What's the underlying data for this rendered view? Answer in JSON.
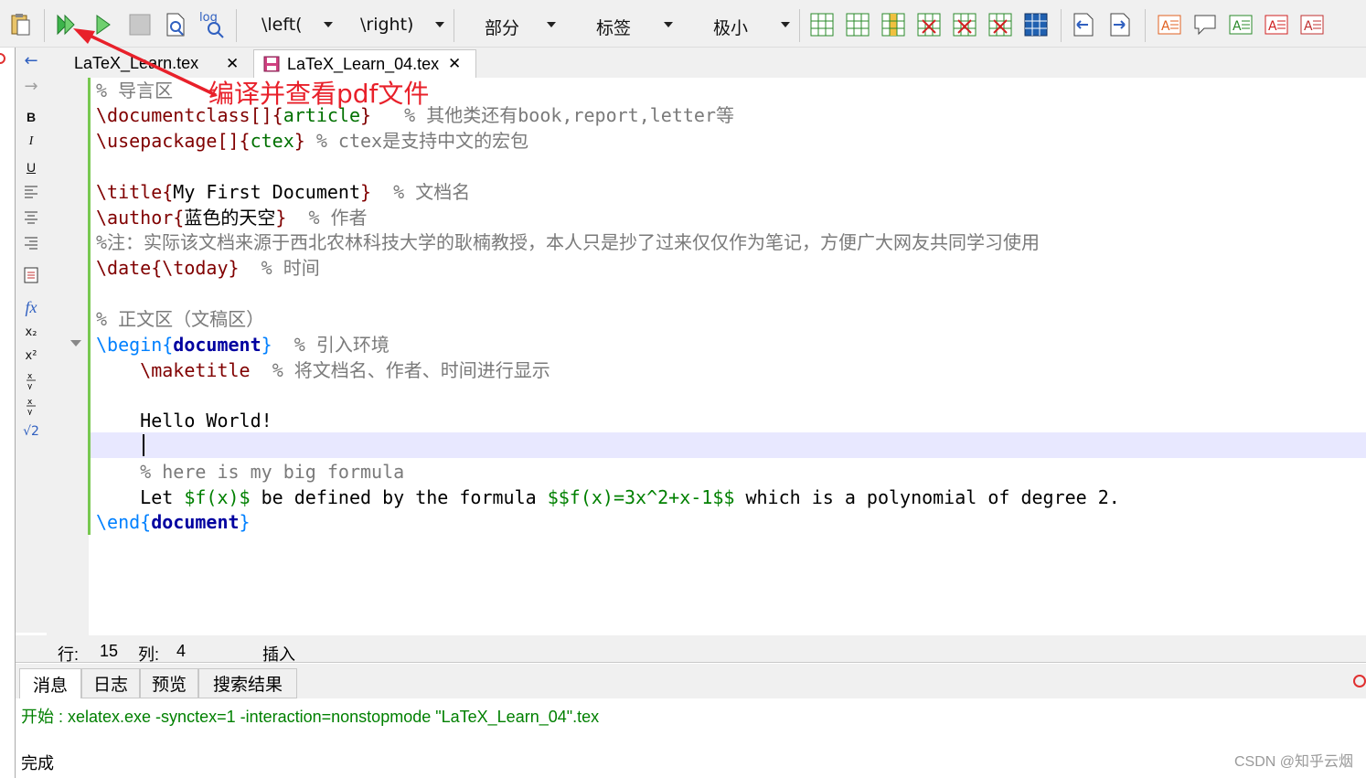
{
  "toolbar": {
    "icons": [
      "paste-icon",
      "build-view-icon",
      "compile-icon",
      "stop-icon",
      "view-pdf-icon",
      "view-log-icon"
    ],
    "log_label": "log",
    "dropdowns": [
      {
        "name": "left-delim",
        "value": "\\left("
      },
      {
        "name": "right-delim",
        "value": "\\right)"
      },
      {
        "name": "section",
        "value": "部分"
      },
      {
        "name": "label",
        "value": "标签"
      },
      {
        "name": "size",
        "value": "极小"
      }
    ]
  },
  "formatbar": {
    "bold": "B",
    "italic": "I",
    "underline": "U",
    "fx": "fx",
    "sub": "x₂",
    "sup": "x²",
    "frac": "x/y",
    "dfrac": "x/y",
    "sqrt": "√2"
  },
  "tabs": [
    {
      "label": "LaTeX_Learn.tex",
      "close": "✕"
    },
    {
      "label": "LaTeX_Learn_04.tex",
      "close": "✕"
    }
  ],
  "editor": {
    "l1_c": "% 导言区",
    "l2_k": "\\documentclass[]{",
    "l2_a": "article",
    "l2_e": "}",
    "l2_c": "% 其他类还有book,report,letter等",
    "l3_k": "\\usepackage[]{",
    "l3_a": "ctex",
    "l3_e": "}",
    "l3_c": "% ctex是支持中文的宏包",
    "l5_k": "\\title{",
    "l5_a": "My First Document",
    "l5_e": "}",
    "l5_c": "% 文档名",
    "l6_k": "\\author{",
    "l6_a": "蓝色的天空",
    "l6_e": "}",
    "l6_c": "% 作者",
    "l7_c": "%注：实际该文档来源于西北农林科技大学的耿楠教授，本人只是抄了过来仅仅作为笔记，方便广大网友共同学习使用",
    "l8_k": "\\date{",
    "l8_a": "\\today",
    "l8_e": "}",
    "l8_c": "% 时间",
    "l10_c": "% 正文区（文稿区）",
    "l11_k": "\\begin{",
    "l11_a": "document",
    "l11_e": "}",
    "l11_c": "% 引入环境",
    "l12_k": "\\maketitle",
    "l12_c": "% 将文档名、作者、时间进行显示",
    "l14_p": "Hello World!",
    "l16_c": "% here is my big formula",
    "l17_p1": "Let ",
    "l17_m1": "$f(x)$",
    "l17_p2": " be defined by the formula ",
    "l17_m2": "$$f(x)=3x^2+x-1$$",
    "l17_p3": " which is a polynomial of degree 2.",
    "l18_k": "\\end{",
    "l18_a": "document",
    "l18_e": "}"
  },
  "status": {
    "row_label": "行:",
    "row": "15",
    "col_label": "列:",
    "col": "4",
    "mode": "插入"
  },
  "bottom_tabs": [
    "消息",
    "日志",
    "预览",
    "搜索结果"
  ],
  "messages": {
    "line1": "开始 : xelatex.exe -synctex=1 -interaction=nonstopmode \"LaTeX_Learn_04\".tex",
    "line2": "完成"
  },
  "annotation": "编译并查看pdf文件",
  "watermark": "CSDN @知乎云烟",
  "colors": {
    "annotation": "#e8202a",
    "comment": "#7a7a7a",
    "command": "#800000",
    "argument": "#007000",
    "environment": "#0080ff",
    "math": "#008000",
    "message_ok": "#008000"
  }
}
